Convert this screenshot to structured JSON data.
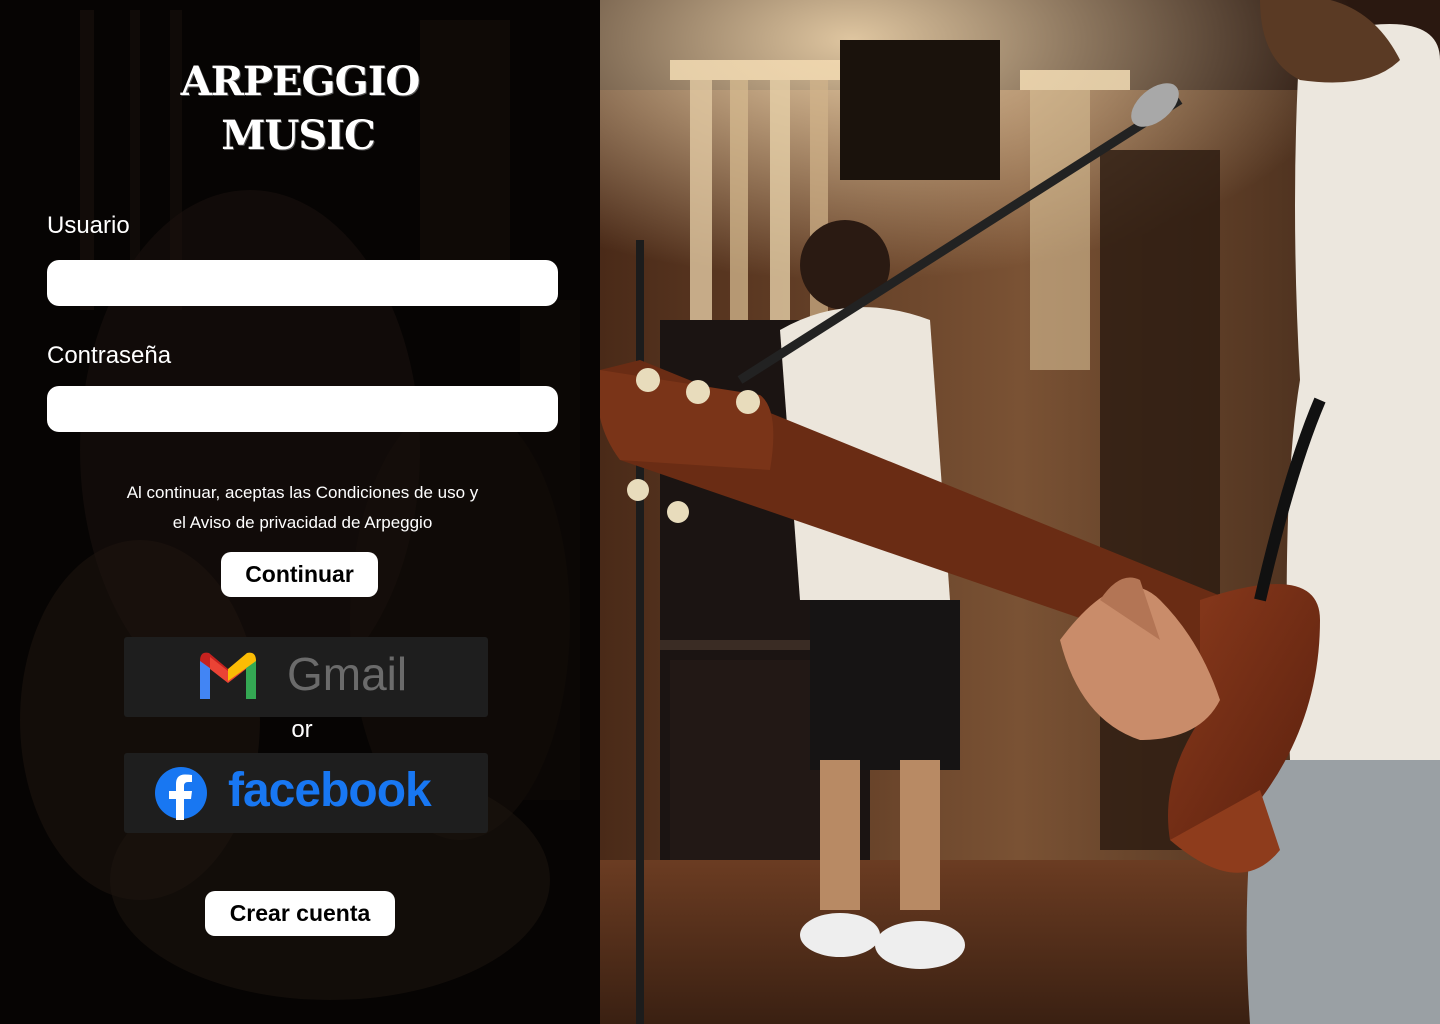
{
  "brand": {
    "line1": "ARPEGGIO",
    "line2": "MUSIC"
  },
  "form": {
    "user_label": "Usuario",
    "user_value": "",
    "password_label": "Contraseña",
    "password_value": "",
    "terms_line1": "Al continuar, aceptas las Condiciones de uso y",
    "terms_line2": "el Aviso de privacidad de Arpeggio",
    "continue_label": "Continuar"
  },
  "social": {
    "gmail_label": "Gmail",
    "or_label": "or",
    "facebook_label": "facebook"
  },
  "footer": {
    "create_account_label": "Crear cuenta"
  },
  "colors": {
    "panel_bg": "#070504",
    "facebook_blue": "#1877f2",
    "gmail_red": "#ea4335",
    "gmail_blue": "#4285f4",
    "gmail_green": "#34a853",
    "gmail_yellow": "#fbbc04"
  },
  "icons": {
    "gmail": "gmail-logo-icon",
    "facebook": "facebook-logo-icon"
  }
}
